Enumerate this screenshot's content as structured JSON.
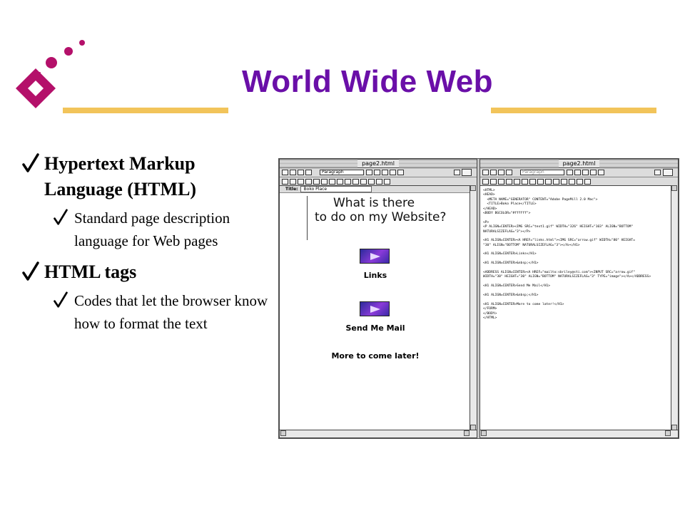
{
  "colors": {
    "title": "#6a0fa8",
    "accent_rule": "#f2c45a",
    "logo": "#b4106a",
    "check": "#000000"
  },
  "slide": {
    "title": "World Wide Web",
    "bullets": [
      {
        "text": "Hypertext Markup Language (HTML)",
        "sub": [
          "Standard page description language for Web pages"
        ]
      },
      {
        "text": "HTML tags",
        "sub": [
          "Codes that let the browser know how to format the text"
        ]
      }
    ]
  },
  "screenshot": {
    "left_window": {
      "title": "page2.html",
      "format_select": "Paragraph",
      "title_label": "Title:",
      "title_value": "Boko Place",
      "heading": [
        "What is there",
        "to do on my Website?"
      ],
      "links_label": "Links",
      "mail_label": "Send Me Mail",
      "more_label": "More to come later!"
    },
    "right_window": {
      "title": "page2.html",
      "format_select": "Paragraph",
      "code_lines": [
        "<HTML>",
        "<HEAD>",
        "  <META NAME=\"GENERATOR\" CONTENT=\"Adobe PageMill 2.0 Mac\">",
        "  <TITLE>Boko Place</TITLE>",
        "</HEAD>",
        "<BODY BGCOLOR=\"#ffffff\">",
        "",
        "<P>",
        "<P ALIGN=CENTER><IMG SRC=\"text1.gif\" WIDTH=\"326\" HEIGHT=\"103\" ALIGN=\"BOTTOM\"",
        "NATURALSIZEFLAG=\"3\"></P>",
        "",
        "<H1 ALIGN=CENTER><A HREF=\"links.html\"><IMG SRC=\"arrow.gif\" WIDTH=\"80\" HEIGHT=",
        "\"30\" ALIGN=\"BOTTOM\" NATURALSIZEFLAG=\"3\"></A></H1>",
        "",
        "<H1 ALIGN=CENTER>Links</H1>",
        "",
        "<H1 ALIGN=CENTER>&nbsp;</H1>",
        "",
        "<ADDRESS ALIGN=CENTER><A HREF=\"mailto:sbriley@sti.com\"><INPUT SRC=\"arrow.gif\"",
        "WIDTH=\"30\" HEIGHT=\"30\" ALIGN=\"BOTTOM\" NATURALSIZEFLAG=\"3\" TYPE=\"image\"></A></ADDRESS>",
        "",
        "<H1 ALIGN=CENTER>Send Me Mail</H1>",
        "",
        "<H1 ALIGN=CENTER>&nbsp;</H1>",
        "",
        "<H1 ALIGN=CENTER>More to come later!</H1>",
        "</FORM>",
        "</BODY>",
        "</HTML>"
      ]
    }
  }
}
